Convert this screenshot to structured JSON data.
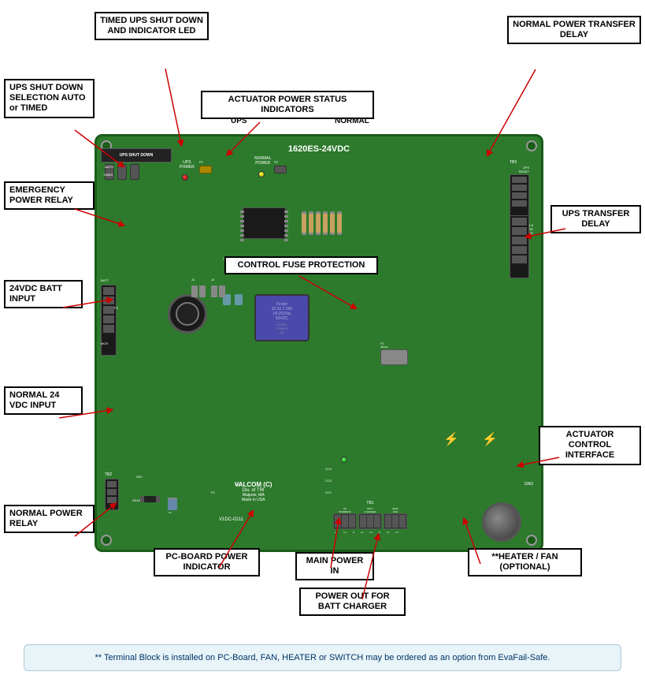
{
  "board": {
    "model": "1620ES-24VDC",
    "manufacturer": "VALCOM (C)",
    "division": "Div. of TRI",
    "location": "Walpole, MA",
    "origin": "Made in USA",
    "part": "V1DC-0211"
  },
  "labels": {
    "timed_ups": "TIMED UPS SHUT DOWN AND INDICATOR LED",
    "ups_shutdown": "UPS SHUT DOWN SELECTION AUTO or TIMED",
    "actuator_power": "ACTUATOR POWER STATUS INDICATORS",
    "ups_label": "UPS",
    "normal_label": "NORMAL",
    "normal_power_transfer": "NORMAL POWER TRANSFER DELAY",
    "emergency_relay": "EMERGENCY POWER RELAY",
    "ups_transfer": "UPS TRANSFER DELAY",
    "control_fuse": "CONTROL FUSE PROTECTION",
    "batt_24vdc": "24VDC BATT INPUT",
    "normal_24vdc": "NORMAL 24 VDC INPUT",
    "normal_power_relay": "NORMAL POWER RELAY",
    "pc_board_indicator": "PC-BOARD POWER INDICATOR",
    "main_power": "MAIN POWER IN",
    "heater_fan": "**HEATER / FAN (OPTIONAL)",
    "power_out_batt": "POWER OUT FOR BATT CHARGER",
    "actuator_control": "ACTUATOR CONTROL INTERFACE"
  },
  "note": {
    "text": "** Terminal Block is installed on PC-Board, FAN, HEATER or SWITCH may be ordered as an option from EvaFail-Safe."
  }
}
